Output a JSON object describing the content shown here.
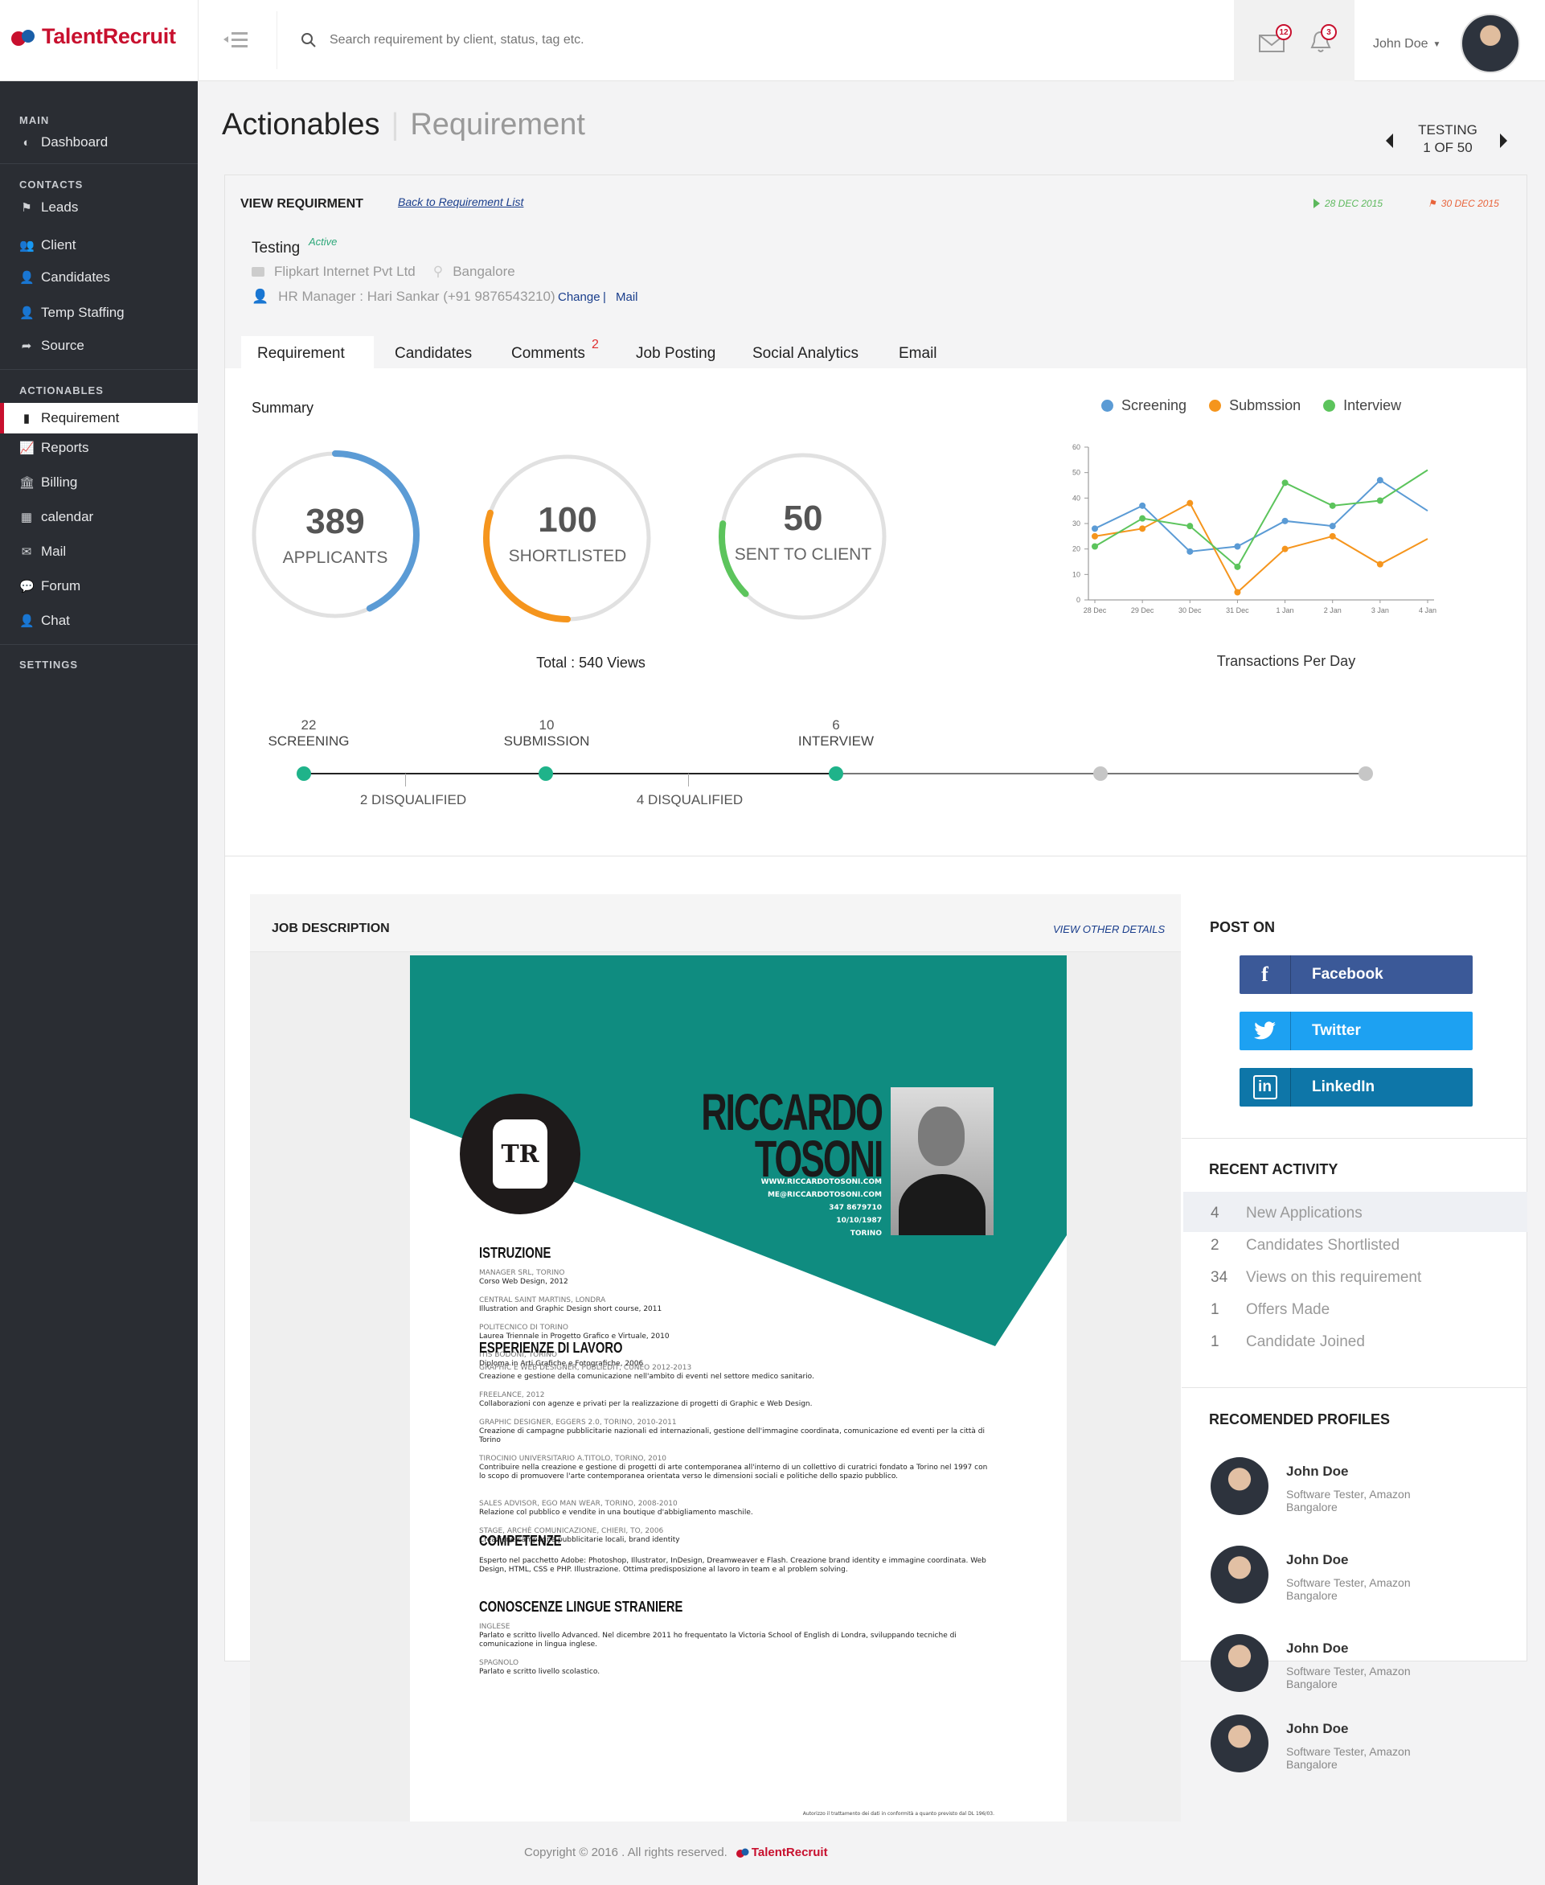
{
  "brand": {
    "name": "TalentRecruit"
  },
  "header": {
    "search_placeholder": "Search requirement by client, status, tag etc.",
    "mail_count": "12",
    "bell_count": "3",
    "user_name": "John Doe"
  },
  "sidebar": {
    "sections": [
      {
        "title": "MAIN",
        "items": [
          {
            "label": "Dashboard",
            "icon": "dashboard-icon"
          }
        ]
      },
      {
        "title": "CONTACTS",
        "items": [
          {
            "label": "Leads",
            "icon": "flag-icon"
          },
          {
            "label": "Client",
            "icon": "users-icon"
          },
          {
            "label": "Candidates",
            "icon": "candidates-icon"
          },
          {
            "label": "Temp Staffing",
            "icon": "user-icon"
          },
          {
            "label": "Source",
            "icon": "share-icon"
          }
        ]
      },
      {
        "title": "ACTIONABLES",
        "items": [
          {
            "label": "Requirement",
            "icon": "clipboard-icon",
            "active": true
          },
          {
            "label": "Reports",
            "icon": "chart-icon"
          },
          {
            "label": "Billing",
            "icon": "bank-icon"
          },
          {
            "label": "calendar",
            "icon": "calendar-icon"
          },
          {
            "label": "Mail",
            "icon": "mail-icon"
          },
          {
            "label": "Forum",
            "icon": "forum-icon"
          },
          {
            "label": "Chat",
            "icon": "chat-icon"
          }
        ]
      },
      {
        "title": "SETTINGS",
        "items": []
      }
    ]
  },
  "page": {
    "title": "Actionables",
    "subtitle": "Requirement",
    "pager_label": "TESTING",
    "pager_count": "1 OF 50"
  },
  "view": {
    "heading": "VIEW REQUIRMENT",
    "back_link": "Back to Requirement List",
    "start_date": "28 DEC 2015",
    "end_date": "30 DEC 2015",
    "req_name": "Testing",
    "status": "Active",
    "company": "Flipkart Internet Pvt Ltd",
    "location": "Bangalore",
    "hr": "HR Manager : Hari Sankar (+91 9876543210)",
    "change": "Change",
    "sep": "|",
    "mail": "Mail"
  },
  "tabs": [
    {
      "label": "Requirement",
      "active": true
    },
    {
      "label": "Candidates"
    },
    {
      "label": "Comments",
      "badge": "2"
    },
    {
      "label": "Job Posting"
    },
    {
      "label": "Social Analytics"
    },
    {
      "label": "Email"
    }
  ],
  "summary": {
    "title": "Summary",
    "rings": [
      {
        "value": "389",
        "label": "APPLICANTS",
        "fill": 0.43,
        "color": "#5b9bd5"
      },
      {
        "value": "100",
        "label": "SHORTLISTED",
        "fill": 0.3,
        "color": "#f5951d"
      },
      {
        "value": "50",
        "label": "SENT TO CLIENT",
        "fill": 0.15,
        "color": "#5cc45c"
      }
    ],
    "total": "Total : 540 Views"
  },
  "chart_data": {
    "type": "line",
    "categories": [
      "28 Dec",
      "29 Dec",
      "30 Dec",
      "31 Dec",
      "1 Jan",
      "2 Jan",
      "3 Jan",
      "4 Jan"
    ],
    "x_positions": [
      0,
      1,
      2,
      3,
      4,
      5,
      6,
      7
    ],
    "series": [
      {
        "name": "Screening",
        "color": "#5b9bd5",
        "points": [
          [
            0,
            28
          ],
          [
            1,
            37
          ],
          [
            2,
            19
          ],
          [
            3,
            21
          ],
          [
            4,
            31
          ],
          [
            5,
            29
          ],
          [
            6,
            47
          ],
          [
            7,
            35
          ]
        ]
      },
      {
        "name": "Submssion",
        "color": "#f5951d",
        "points": [
          [
            0,
            25
          ],
          [
            1,
            28
          ],
          [
            2,
            38
          ],
          [
            3,
            3
          ],
          [
            4,
            20
          ],
          [
            5,
            25
          ],
          [
            6,
            14
          ],
          [
            7,
            24
          ]
        ]
      },
      {
        "name": "Interview",
        "color": "#5cc45c",
        "points": [
          [
            0,
            21
          ],
          [
            1,
            32
          ],
          [
            2,
            29
          ],
          [
            3,
            13
          ],
          [
            4,
            46
          ],
          [
            5,
            37
          ],
          [
            6,
            39
          ],
          [
            7,
            51
          ]
        ]
      }
    ],
    "ylim": [
      0,
      60
    ],
    "yticks": [
      0,
      10,
      20,
      30,
      40,
      50,
      60
    ],
    "caption": "Transactions Per Day"
  },
  "pipeline": {
    "stages": [
      {
        "count": "22",
        "label": "SCREENING",
        "done": true
      },
      {
        "count": "10",
        "label": "SUBMISSION",
        "done": true
      },
      {
        "count": "6",
        "label": "INTERVIEW",
        "done": true
      },
      {
        "count": "",
        "label": "",
        "done": false
      },
      {
        "count": "",
        "label": "",
        "done": false
      }
    ],
    "disqualified": [
      "2 DISQUALIFIED",
      "4 DISQUALIFIED"
    ]
  },
  "job": {
    "heading": "JOB DESCRIPTION",
    "link": "VIEW OTHER DETAILS"
  },
  "cv": {
    "first": "RICCARDO",
    "last": "TOSONI",
    "contact": [
      "WWW.RICCARDOTOSONI.COM",
      "ME@RICCARDOTOSONI.COM",
      "347 8679710",
      "10/10/1987",
      "TORINO"
    ],
    "logo": "TR",
    "sections": [
      {
        "title": "ISTRUZIONE",
        "entries": [
          {
            "h": "MANAGER SRL, TORINO",
            "t": "Corso Web Design, 2012"
          },
          {
            "h": "CENTRAL SAINT MARTINS, LONDRA",
            "t": "Illustration and Graphic Design short course, 2011"
          },
          {
            "h": "POLITECNICO DI TORINO",
            "t": "Laurea Triennale in Progetto Grafico e Virtuale, 2010"
          },
          {
            "h": "ITIS BODONI, TORINO",
            "t": "Diploma in Arti Grafiche e Fotografiche, 2006"
          }
        ]
      },
      {
        "title": "ESPERIENZE DI LAVORO",
        "entries": [
          {
            "h": "GRAPHIC E WEB DESIGNER, PUBLIEDIT, CUNEO 2012-2013",
            "t": "Creazione e gestione della comunicazione nell'ambito di eventi nel settore medico sanitario."
          },
          {
            "h": "FREELANCE, 2012",
            "t": "Collaborazioni con agenze e privati per la realizzazione di progetti di Graphic e Web Design."
          },
          {
            "h": "GRAPHIC DESIGNER, EGGERS 2.0, TORINO, 2010-2011",
            "t": "Creazione di campagne pubblicitarie nazionali ed internazionali, gestione dell'immagine coordinata, comunicazione ed eventi per la città di Torino"
          },
          {
            "h": "TIROCINIO UNIVERSITARIO A.TITOLO, TORINO, 2010",
            "t": "Contribuire nella creazione e gestione di progetti di arte contemporanea all'interno di un collettivo di curatrici fondato a Torino nel 1997 con lo scopo di promuovere l'arte contemporanea orientata verso le dimensioni sociali e politiche dello spazio pubblico."
          },
          {
            "h": "SALES ADVISOR, EGO MAN WEAR, TORINO, 2008-2010",
            "t": "Relazione col pubblico e vendite in una boutique d'abbigliamento maschile."
          },
          {
            "h": "STAGE, ARCHÈ COMUNICAZIONE, CHIERI, TO, 2006",
            "t": "Creazione campagne pubblicitarie locali, brand identity"
          }
        ]
      },
      {
        "title": "COMPETENZE",
        "entries": [
          {
            "h": "",
            "t": "Esperto nel pacchetto Adobe: Photoshop, Illustrator, InDesign, Dreamweaver e Flash. Creazione brand identity e immagine coordinata. Web Design, HTML, CSS e PHP. Illustrazione. Ottima predisposizione al lavoro in team e al problem solving."
          }
        ]
      },
      {
        "title": "CONOSCENZE LINGUE STRANIERE",
        "entries": [
          {
            "h": "INGLESE",
            "t": "Parlato e scritto livello Advanced. Nel dicembre 2011 ho frequentato la Victoria School of English di Londra, sviluppando tecniche di comunicazione in lingua inglese."
          },
          {
            "h": "SPAGNOLO",
            "t": "Parlato e scritto livello scolastico."
          }
        ]
      }
    ],
    "footer": "Autorizzo il trattamento dei dati in conformità a quanto previsto dal DL 196/03."
  },
  "post_on": {
    "heading": "POST ON",
    "buttons": [
      {
        "label": "Facebook",
        "icon": "facebook-icon",
        "color": "#3b5998",
        "glyph": "f"
      },
      {
        "label": "Twitter",
        "icon": "twitter-icon",
        "color": "#1da1f2",
        "glyph": "🐦"
      },
      {
        "label": "LinkedIn",
        "icon": "linkedin-icon",
        "color": "#0e76a8",
        "glyph": "in"
      }
    ]
  },
  "recent": {
    "heading": "RECENT ACTIVITY",
    "items": [
      {
        "n": "4",
        "label": "New Applications"
      },
      {
        "n": "2",
        "label": "Candidates Shortlisted"
      },
      {
        "n": "34",
        "label": "Views on this requirement"
      },
      {
        "n": "1",
        "label": "Offers Made"
      },
      {
        "n": "1",
        "label": "Candidate Joined"
      }
    ]
  },
  "profiles": {
    "heading": "RECOMENDED PROFILES",
    "items": [
      {
        "name": "John Doe",
        "role": "Software Tester, Amazon",
        "city": "Bangalore"
      },
      {
        "name": "John Doe",
        "role": "Software Tester, Amazon",
        "city": "Bangalore"
      },
      {
        "name": "John Doe",
        "role": "Software Tester, Amazon",
        "city": "Bangalore"
      },
      {
        "name": "John Doe",
        "role": "Software Tester, Amazon",
        "city": "Bangalore"
      }
    ]
  },
  "footer": {
    "copyright": "Copyright © 2016 . All rights reserved.",
    "brand": "TalentRecruit"
  }
}
